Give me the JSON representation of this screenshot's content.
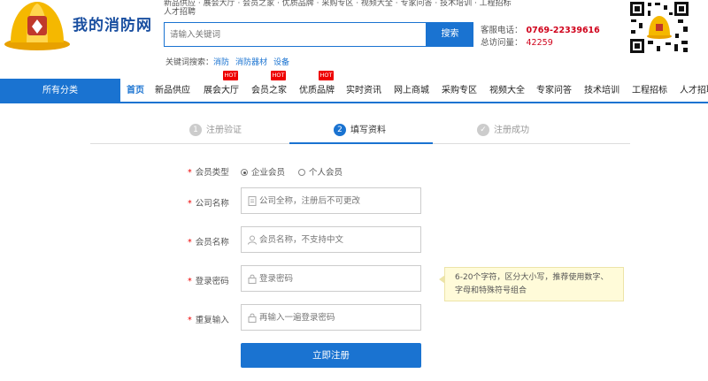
{
  "header": {
    "site_name": "我的消防网",
    "top_links": "新品供应 · 展会大厅 · 会员之家 · 优质品牌 · 采购专区 · 视频大全 · 专家问答 · 技术培训 · 工程招标",
    "top_links2": "人才招聘",
    "search_placeholder": "请输入关键词",
    "search_button": "搜索",
    "hotline_label": "客服电话：",
    "hotline_number": "0769-22339616",
    "visits_label": "总访问量：",
    "visits_count": "42259",
    "keywords_label": "关键词搜索：",
    "keywords": [
      "消防",
      "消防器材",
      "设备"
    ]
  },
  "nav": {
    "all_categories": "所有分类",
    "items": [
      {
        "label": "首页",
        "hot": false
      },
      {
        "label": "新品供应",
        "hot": false
      },
      {
        "label": "展会大厅",
        "hot": true
      },
      {
        "label": "会员之家",
        "hot": true
      },
      {
        "label": "优质品牌",
        "hot": true
      },
      {
        "label": "实时资讯",
        "hot": false
      },
      {
        "label": "网上商城",
        "hot": false
      },
      {
        "label": "采购专区",
        "hot": false
      },
      {
        "label": "视频大全",
        "hot": false
      },
      {
        "label": "专家问答",
        "hot": false
      },
      {
        "label": "技术培训",
        "hot": false
      },
      {
        "label": "工程招标",
        "hot": false
      },
      {
        "label": "人才招聘",
        "hot": false
      }
    ],
    "hot_badge": "HOT"
  },
  "steps": [
    {
      "num": "1",
      "label": "注册验证"
    },
    {
      "num": "2",
      "label": "填写资料"
    },
    {
      "num": "✓",
      "label": "注册成功"
    }
  ],
  "form": {
    "member_type_label": "会员类型",
    "member_type_options": [
      "企业会员",
      "个人会员"
    ],
    "company_label": "公司名称",
    "company_placeholder": "公司全称，注册后不可更改",
    "member_name_label": "会员名称",
    "member_name_placeholder": "会员名称，不支持中文",
    "password_label": "登录密码",
    "password_placeholder": "登录密码",
    "confirm_label": "重复输入",
    "confirm_placeholder": "再输入一遍登录密码",
    "required_mark": "*",
    "password_tip": "6-20个字符，区分大小写，推荐使用数字、字母和特殊符号组合",
    "submit": "立即注册"
  },
  "colors": {
    "brand_blue": "#1a73d1",
    "hot_red": "#e00000",
    "number_red": "#d0021b"
  }
}
